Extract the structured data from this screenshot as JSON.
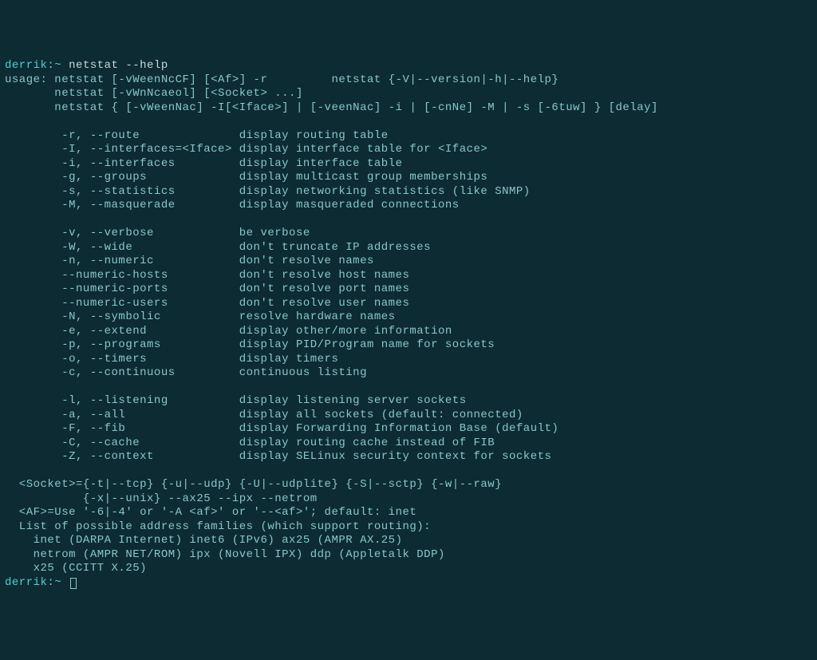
{
  "prompt1": {
    "user": "derrik",
    "sep": ":",
    "path": "~",
    "command": "netstat --help"
  },
  "usage": {
    "l1": "usage: netstat [-vWeenNcCF] [<Af>] -r         netstat {-V|--version|-h|--help}",
    "l2": "       netstat [-vWnNcaeol] [<Socket> ...]",
    "l3": "       netstat { [-vWeenNac] -I[<Iface>] | [-veenNac] -i | [-cnNe] -M | -s [-6tuw] } [delay]"
  },
  "opts": {
    "g1": {
      "r": "        -r, --route              display routing table",
      "I": "        -I, --interfaces=<Iface> display interface table for <Iface>",
      "i": "        -i, --interfaces         display interface table",
      "g": "        -g, --groups             display multicast group memberships",
      "s": "        -s, --statistics         display networking statistics (like SNMP)",
      "M": "        -M, --masquerade         display masqueraded connections"
    },
    "g2": {
      "v": "        -v, --verbose            be verbose",
      "W": "        -W, --wide               don't truncate IP addresses",
      "n": "        -n, --numeric            don't resolve names",
      "nh": "        --numeric-hosts          don't resolve host names",
      "np": "        --numeric-ports          don't resolve port names",
      "nu": "        --numeric-users          don't resolve user names",
      "N": "        -N, --symbolic           resolve hardware names",
      "e": "        -e, --extend             display other/more information",
      "p": "        -p, --programs           display PID/Program name for sockets",
      "o": "        -o, --timers             display timers",
      "c": "        -c, --continuous         continuous listing"
    },
    "g3": {
      "l": "        -l, --listening          display listening server sockets",
      "a": "        -a, --all                display all sockets (default: connected)",
      "F": "        -F, --fib                display Forwarding Information Base (default)",
      "C": "        -C, --cache              display routing cache instead of FIB",
      "Z": "        -Z, --context            display SELinux security context for sockets"
    }
  },
  "footer": {
    "s1": "  <Socket>={-t|--tcp} {-u|--udp} {-U|--udplite} {-S|--sctp} {-w|--raw}",
    "s2": "           {-x|--unix} --ax25 --ipx --netrom",
    "af": "  <AF>=Use '-6|-4' or '-A <af>' or '--<af>'; default: inet",
    "list": "  List of possible address families (which support routing):",
    "f1": "    inet (DARPA Internet) inet6 (IPv6) ax25 (AMPR AX.25)",
    "f2": "    netrom (AMPR NET/ROM) ipx (Novell IPX) ddp (Appletalk DDP)",
    "f3": "    x25 (CCITT X.25)"
  },
  "prompt2": {
    "user": "derrik",
    "sep": ":",
    "path": "~"
  }
}
